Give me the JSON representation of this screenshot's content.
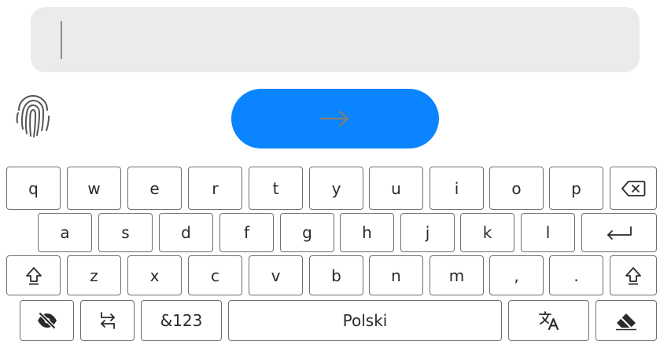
{
  "input": {
    "value": "",
    "placeholder": ""
  },
  "icons": {
    "fingerprint": "fingerprint-icon",
    "submit_arrow": "arrow-right-icon",
    "backspace": "backspace-icon",
    "enter": "enter-icon",
    "shift": "shift-icon",
    "hide_keyboard": "eye-off-icon",
    "switch_input": "swap-arrows-icon",
    "translate": "translate-icon",
    "clear": "eraser-icon"
  },
  "colors": {
    "submit_button": "#0a84ff",
    "input_background": "#ebebeb",
    "key_border": "#6f6f6f"
  },
  "keyboard": {
    "row1": [
      "q",
      "w",
      "e",
      "r",
      "t",
      "y",
      "u",
      "i",
      "o",
      "p"
    ],
    "row2": [
      "a",
      "s",
      "d",
      "f",
      "g",
      "h",
      "j",
      "k",
      "l"
    ],
    "row3": [
      "z",
      "x",
      "c",
      "v",
      "b",
      "n",
      "m",
      ",",
      "."
    ],
    "symbols_label": "&123",
    "space_label": "Polski"
  }
}
